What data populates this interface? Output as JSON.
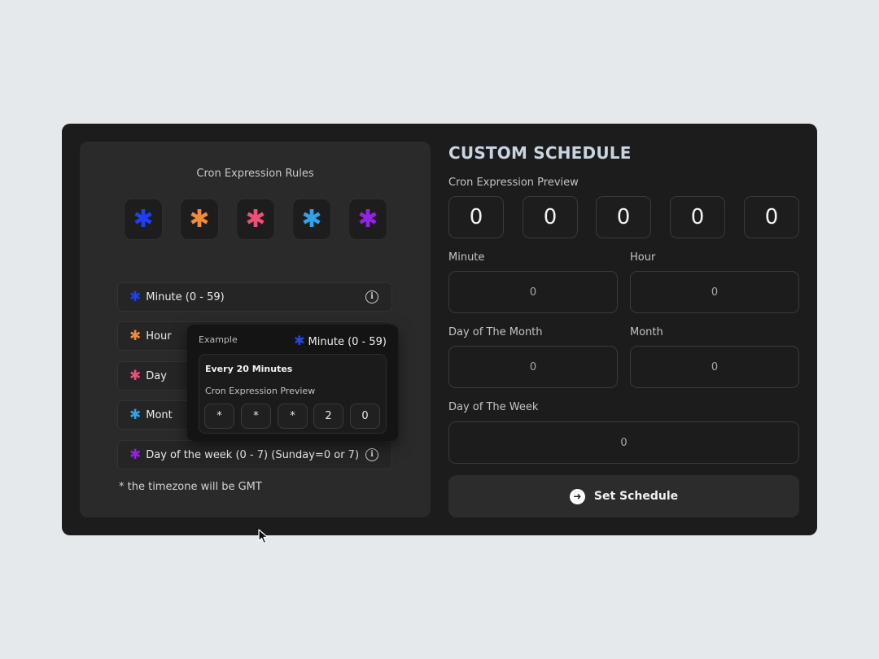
{
  "rules_panel": {
    "title": "Cron Expression Rules",
    "stars": [
      {
        "glyph": "✱",
        "color": "#1f3ef5"
      },
      {
        "glyph": "✱",
        "color": "#f08a3c"
      },
      {
        "glyph": "✱",
        "color": "#ec4f77"
      },
      {
        "glyph": "✱",
        "color": "#2fa2ea"
      },
      {
        "glyph": "✱",
        "color": "#9422e3"
      }
    ],
    "rules": [
      {
        "label": "Minute (0 - 59)",
        "color": "#1f3ef5"
      },
      {
        "label": "Hour",
        "color": "#f08a3c"
      },
      {
        "label": "Day",
        "color": "#ec4f77"
      },
      {
        "label": "Mont",
        "color": "#2fa2ea"
      },
      {
        "label": "Day of the week (0 - 7) (Sunday=0 or 7)",
        "color": "#9422e3"
      }
    ],
    "timezone_note": "* the timezone will be GMT"
  },
  "tooltip": {
    "label": "Example",
    "rule": "Minute (0 - 59)",
    "example_title": "Every 20 Minutes",
    "preview_label": "Cron Expression Preview",
    "digits": [
      "*",
      "*",
      "*",
      "2",
      "0"
    ]
  },
  "schedule": {
    "title": "CUSTOM SCHEDULE",
    "preview_label": "Cron Expression Preview",
    "preview_digits": [
      "0",
      "0",
      "0",
      "0",
      "0"
    ],
    "fields": {
      "minute": {
        "label": "Minute",
        "value": "0"
      },
      "hour": {
        "label": "Hour",
        "value": "0"
      },
      "day_of_month": {
        "label": "Day of The Month",
        "value": "0"
      },
      "month": {
        "label": "Month",
        "value": "0"
      },
      "day_of_week": {
        "label": "Day of The Week",
        "value": "0"
      }
    },
    "submit_label": "Set Schedule"
  },
  "icons": {
    "info": "info-icon",
    "arrow": "arrow-right-circle-icon",
    "cursor": "mouse-cursor-icon"
  }
}
